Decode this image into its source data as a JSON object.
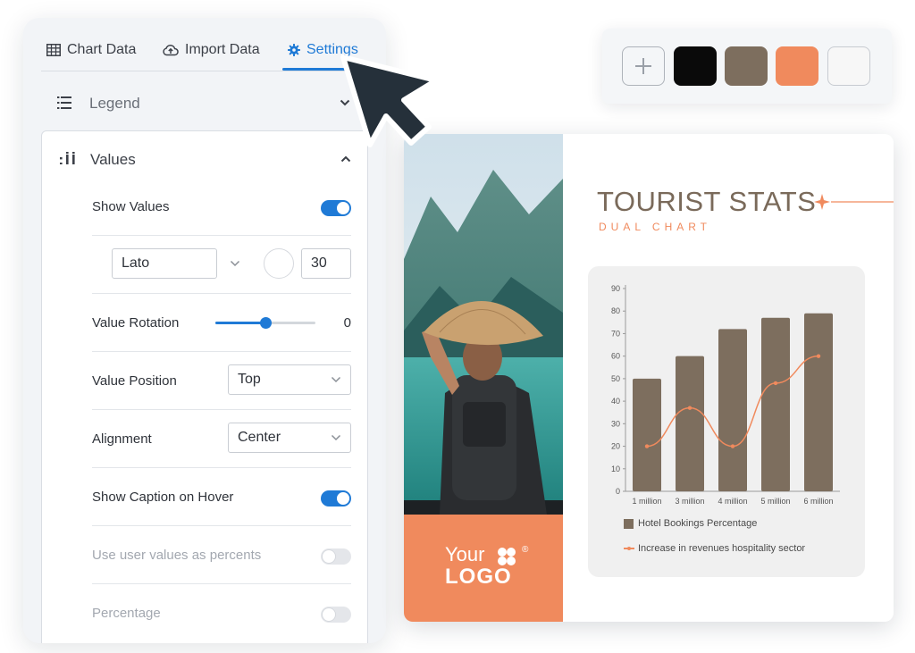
{
  "tabs": [
    {
      "label": "Chart Data",
      "icon": "table-icon"
    },
    {
      "label": "Import Data",
      "icon": "cloud-upload-icon"
    },
    {
      "label": "Settings",
      "icon": "gear-icon",
      "active": true
    }
  ],
  "legend_section": {
    "label": "Legend",
    "icon": "list-icon",
    "expanded": false
  },
  "values_section": {
    "label": "Values",
    "icon": "values-bars-icon",
    "expanded": true,
    "show_values": {
      "label": "Show Values",
      "on": true
    },
    "font": {
      "family": "Lato",
      "size": "30"
    },
    "value_rotation": {
      "label": "Value Rotation",
      "value": "0",
      "fraction": 0.5
    },
    "value_position": {
      "label": "Value Position",
      "selected": "Top"
    },
    "alignment": {
      "label": "Alignment",
      "selected": "Center"
    },
    "show_caption_on_hover": {
      "label": "Show Caption on Hover",
      "on": true
    },
    "user_values_percent": {
      "label": "Use user values as percents",
      "on": false
    },
    "percentage": {
      "label": "Percentage",
      "on": false
    }
  },
  "palette": {
    "add_icon": "plus-icon",
    "swatches": [
      "#0a0a0a",
      "#7d6e5e",
      "#f08a5d",
      "#f7f7f7"
    ]
  },
  "infographic": {
    "title": "TOURIST STATS",
    "subtitle": "DUAL CHART",
    "logo_line1": "Your",
    "logo_line2": "LOGO",
    "logo_reg": "®",
    "accent": "#f08a5d",
    "brown": "#7d6e5e"
  },
  "chart_data": {
    "type": "bar",
    "categories": [
      "1 million",
      "3 million",
      "4 million",
      "5 million",
      "6 million"
    ],
    "ylim": [
      0,
      90
    ],
    "yticks": [
      0,
      10,
      20,
      30,
      40,
      50,
      60,
      70,
      80,
      90
    ],
    "series": [
      {
        "name": "Hotel Bookings Percentage",
        "type": "bar",
        "values": [
          50,
          60,
          72,
          77,
          79
        ]
      },
      {
        "name": "Increase in revenues hospitality sector",
        "type": "line",
        "values": [
          20,
          37,
          20,
          48,
          60
        ]
      }
    ],
    "legend": "bottom",
    "grid": false
  }
}
